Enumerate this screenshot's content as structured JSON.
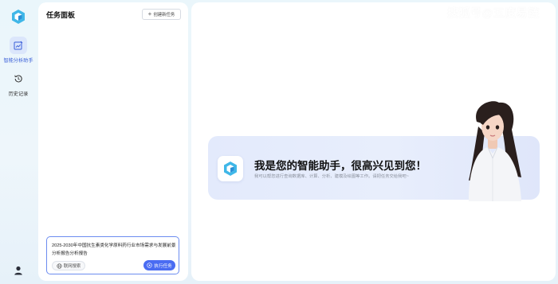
{
  "sidebar": {
    "items": [
      {
        "label": "智能分析助手",
        "icon": "chart-edit-icon",
        "active": true
      },
      {
        "label": "历史记录",
        "icon": "history-icon",
        "active": false
      }
    ],
    "user_icon": "user-icon"
  },
  "task_panel": {
    "title": "任务面板",
    "new_task_label": "创建新任务"
  },
  "composer": {
    "text": "2025-2030年中国抗生素类化学原料药行业市场需求与发展前景分析报告分析报告",
    "web_search_label": "联网搜索",
    "run_label": "执行任务"
  },
  "main": {
    "watermark": "搜狐号@五度易链",
    "welcome_title": "我是您的智能助手，很高兴见到您！",
    "welcome_subtitle": "我可以帮您进行查询数据库、计算、分析、建模及绘图等工作。请把任务交给我吧~"
  },
  "colors": {
    "accent": "#4a6cf2",
    "active_bg": "#dbe6fb",
    "card_bg": "#e6ecfc"
  }
}
